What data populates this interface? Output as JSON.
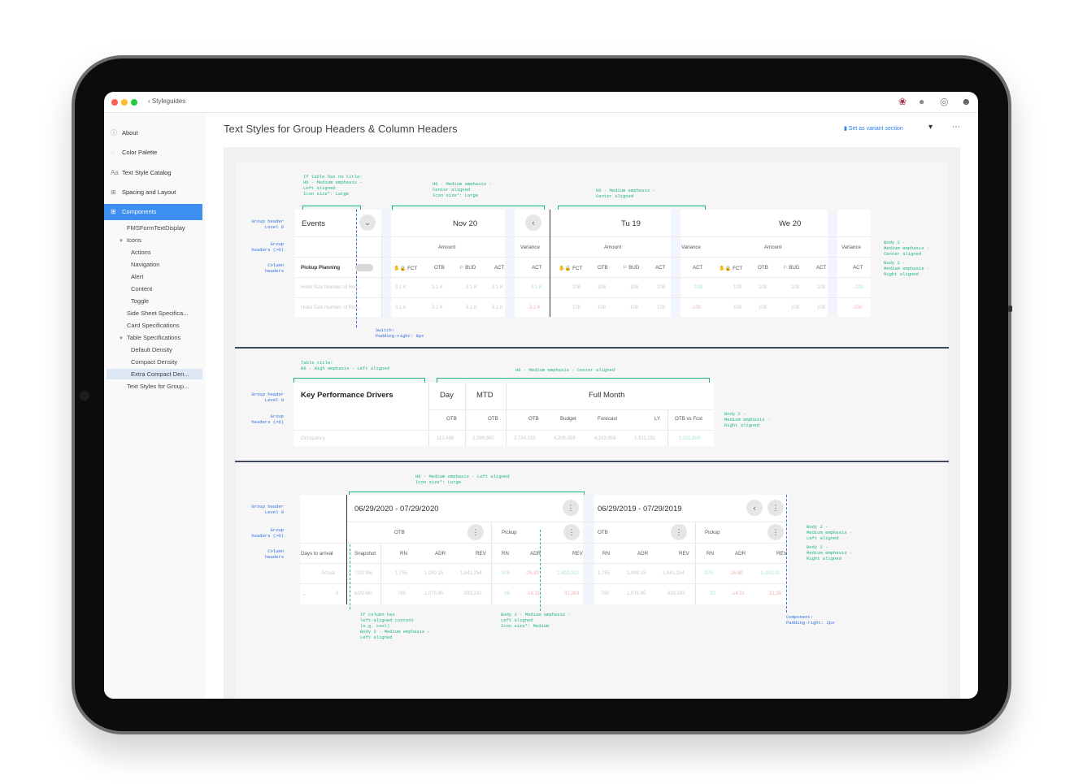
{
  "window": {
    "breadcrumb": "Styleguides"
  },
  "page": {
    "title": "Text Styles for Group Headers & Column Headers",
    "variant_link": "Set as variant section"
  },
  "sidebar": {
    "items": [
      {
        "label": "About"
      },
      {
        "label": "Color Palette"
      },
      {
        "label": "Text Style Catalog"
      },
      {
        "label": "Spacing and Layout"
      },
      {
        "label": "Components"
      }
    ],
    "sub": [
      "FMSFormTextDisplay",
      "Icons",
      "Actions",
      "Navigation",
      "Alert",
      "Content",
      "Toggle",
      "Side Sheet Specifica...",
      "Card Specifications",
      "Table Specifications",
      "Default Density",
      "Compact Density",
      "Extra Compact Den...",
      "Text Styles for Group..."
    ]
  },
  "s1": {
    "ann_top": [
      "If table has no title:\nH6 - Medium emphasis -\nLeft aligned\nIcon size*: Large",
      "H6 - Medium emphasis -\nCenter aligned\nIcon size*: Large",
      "H6 - Medium emphasis -\nCenter aligned"
    ],
    "ann_left": [
      "Group header\nLevel 0",
      "Group\nheaders (>0)",
      "Column\nheaders"
    ],
    "ann_right": [
      "Body 2 -\nMedium emphasis -\nCenter aligned",
      "Body 2 -\nMedium emphasis -\nRight aligned"
    ],
    "switch_note": "Switch:\nPadding-right: 8px",
    "events": "Events",
    "pickup": "Pickup Planning",
    "groups": [
      "Nov 20",
      "Tu 19",
      "We 20"
    ],
    "amount": "Amount",
    "variance": "Variance",
    "cols": [
      "FCT",
      "OTB",
      "BUD",
      "ACT",
      "ACT"
    ],
    "row_labels": [
      "Hotel Size Number of Roo...",
      "Hotel Size Number of Roo..."
    ],
    "r1": [
      "3.1 K",
      "3.1 K",
      "3.1 K",
      "3.1 K",
      "3.1 K"
    ],
    "r2": [
      "3.1 K",
      "3.1 K",
      "3.1 K",
      "3.1 K",
      "-3.1 K"
    ],
    "r3": [
      "108",
      "108",
      "108",
      "108",
      "-100"
    ],
    "r4": [
      "108",
      "108",
      "108",
      "108",
      "-100"
    ]
  },
  "s2": {
    "ann_top": [
      "Table title:\nH6 - High emphasis - Left aligned",
      "H6 - Medium emphasis - Center aligned"
    ],
    "ann_left": [
      "Group header\nLevel 0",
      "Group\nheaders (>0)"
    ],
    "ann_right": "Body 2 -\nMedium emphasis -\nRight aligned",
    "title": "Key Performance Drivers",
    "groups": [
      "Day",
      "MTD",
      "Full Month"
    ],
    "cols": [
      "OTB",
      "OTB",
      "OTB",
      "Budget",
      "Forecast",
      "LY",
      "OTB vs Fcst"
    ],
    "row_label": "Occupancy",
    "row": [
      "112,498",
      "2,399,985",
      "3,724,333",
      "4,205,058",
      "4,163,656",
      "3,911,191",
      "1,311,200"
    ]
  },
  "s3": {
    "ann_top": "H6 - Medium emphasis - Left aligned\nIcon size*: Large",
    "ann_left": [
      "Group header\nLevel 0",
      "Group\nheaders (>0)",
      "Column\nheaders"
    ],
    "ann_right": [
      "Body 2 -\nMedium emphasis -\nLeft aligned",
      "Body 2 -\nMedium emphasis -\nRight aligned"
    ],
    "ann_bottom": [
      "If column has\nleft-aligned content\n(e.g. text)\nBody 2 - Medium emphasis -\nLeft aligned",
      "Body 2 - Medium emphasis -\nLeft aligned\nIcon size*: Medium",
      "Component:\nPadding-right: 2px"
    ],
    "ranges": [
      "06/29/2020 - 07/29/2020",
      "06/29/2019 - 07/29/2019"
    ],
    "sub": [
      "OTB",
      "Pickup",
      "OTB",
      "Pickup"
    ],
    "days": "Days to arrival",
    "snapshot": "Snapshot",
    "cols": [
      "RN",
      "ADR",
      "REV",
      "RN",
      "ADR",
      "REV",
      "RN",
      "ADR",
      "REV",
      "RN",
      "ADR",
      "REV"
    ],
    "actual": "Actual",
    "zero": "0",
    "snap1": "7/29 We",
    "snap2": "6/29 Mo",
    "r1": [
      "1,755",
      "1,049.15",
      "1,841,254",
      "975",
      "-26.80",
      "1,002,012",
      "1,755",
      "1,049.15",
      "1,841,254",
      "975",
      "-26.80",
      "1,002,01"
    ],
    "r2": [
      "780",
      "1,075.95",
      "839,242",
      "39",
      "-14.31",
      "31,363",
      "780",
      "1,075.95",
      "839,242",
      "33",
      "-14.31",
      "31,36"
    ]
  }
}
